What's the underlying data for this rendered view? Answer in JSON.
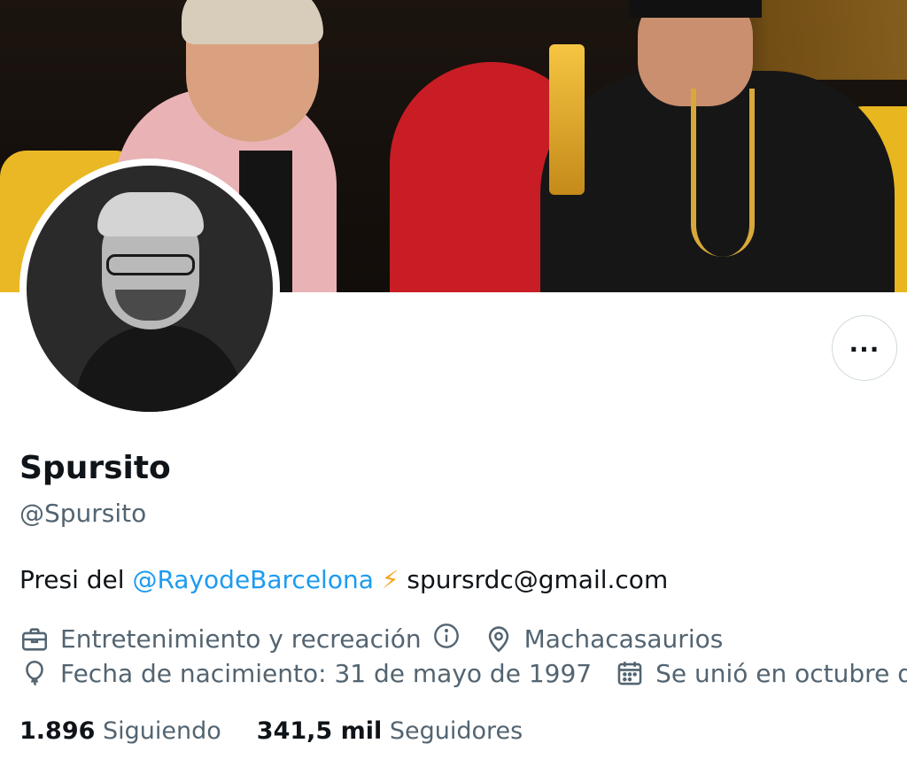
{
  "profile": {
    "display_name": "Spursito",
    "handle": "@Spursito",
    "bio_prefix": "Presi del ",
    "bio_mention": "@RayodeBarcelona",
    "bio_emoji": "⚡",
    "bio_suffix": " spursrdc@gmail.com",
    "category": "Entretenimiento y recreación",
    "location": "Machacasaurios",
    "birthdate": "Fecha de nacimiento: 31 de mayo de 1997",
    "joined": "Se unió en octubre de"
  },
  "stats": {
    "following_count": "1.896",
    "following_label": "Siguiendo",
    "followers_count": "341,5 mil",
    "followers_label": "Seguidores"
  },
  "actions": {
    "more_label": "..."
  },
  "icons": {
    "category": "briefcase-icon",
    "category_info": "info-icon",
    "location": "map-pin-icon",
    "birthdate": "balloon-icon",
    "joined": "calendar-icon",
    "more": "more-horizontal-icon"
  },
  "colors": {
    "text_primary": "#0f1419",
    "text_secondary": "#536471",
    "link": "#1d9bf0",
    "border": "#cfd9de"
  }
}
